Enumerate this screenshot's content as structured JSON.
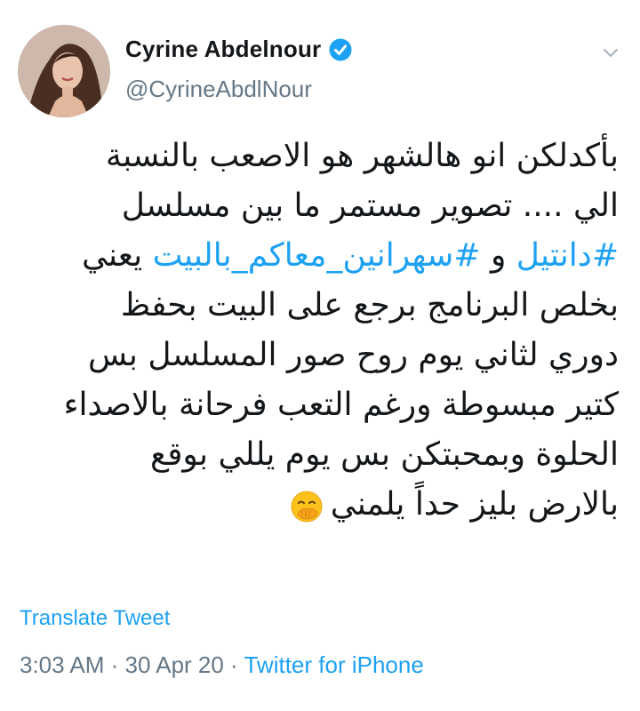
{
  "profile": {
    "display_name": "Cyrine Abdelnour",
    "handle": "@CyrineAbdlNour",
    "avatar_icon": "profile-photo",
    "verified_icon": "verified-badge-icon"
  },
  "tweet": {
    "lines": [
      "بأكدلكن انو هالشهر هو الاصعب بالنسبة",
      "الي .... تصوير مستمر ما بين مسلسل",
      "يعني",
      "بخلص البرنامج برجع على البيت بحفظ",
      "دوري لثاني يوم روح صور المسلسل  بس",
      "كتير مبسوطة ورغم التعب فرحانة بالاصداء",
      "الحلوة وبمحبتكن بس يوم يللي بوقع",
      "بالارض  بليز حداً يلمني"
    ],
    "hashtag_1": "#دانتيل",
    "connector": "و",
    "hashtag_2": "#سهرانين_معاكم_بالبيت",
    "emoji_icon": "hand-over-mouth-emoji"
  },
  "translate_label": "Translate Tweet",
  "meta": {
    "time": "3:03 AM",
    "separator": " · ",
    "date": "30 Apr 20",
    "source": "Twitter for iPhone"
  },
  "colors": {
    "link": "#1da1f2",
    "secondary_text": "#657786",
    "primary_text": "#14171a"
  }
}
